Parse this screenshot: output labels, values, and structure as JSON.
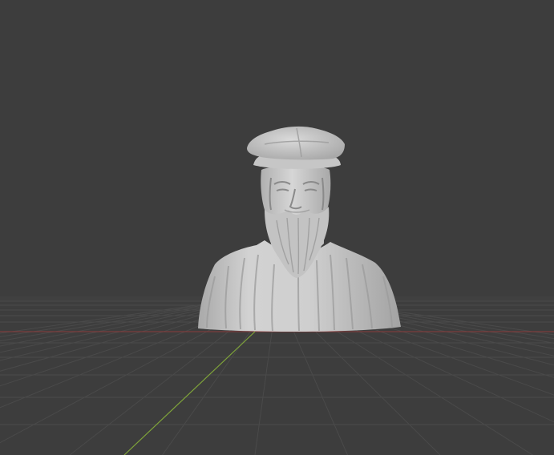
{
  "viewport": {
    "background_color": "#3d3d3d",
    "grid_line_color": "#4a4a4a",
    "horizon_color": "#454545",
    "y_axis_color": "#7fa43a",
    "x_axis_color": "#8a3b3b",
    "model_color": "#c9c9c9",
    "model_shadow_color": "#8e8e8e",
    "object": "bust-sculpture"
  }
}
